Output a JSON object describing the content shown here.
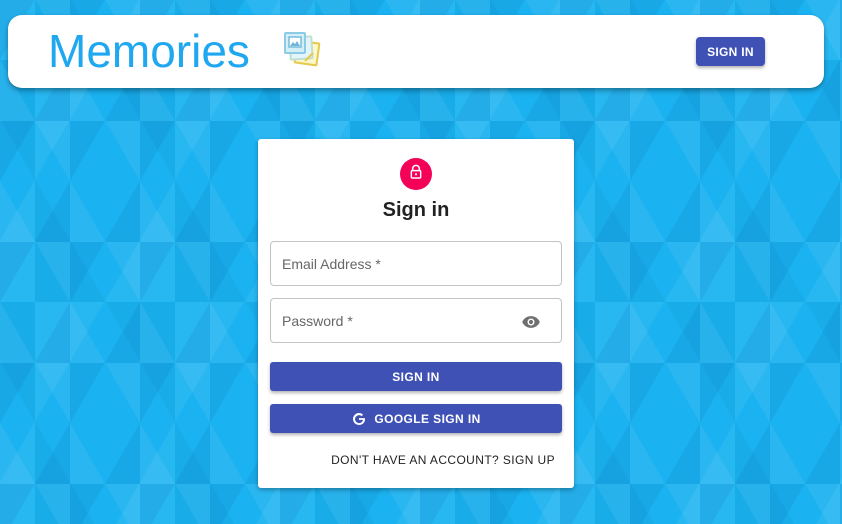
{
  "header": {
    "brand_title": "Memories",
    "brand_logo": "photo-album-icon",
    "signin_label": "SIGN IN"
  },
  "auth_card": {
    "avatar_icon": "lock-icon",
    "title": "Sign in",
    "email_label": "Email Address *",
    "password_label": "Password *",
    "password_toggle_icon": "eye-icon",
    "signin_button_label": "SIGN IN",
    "google_icon": "google-g-icon",
    "google_button_label": "GOOGLE SIGN IN",
    "switch_mode_label": "DON'T HAVE AN ACCOUNT? SIGN UP"
  },
  "colors": {
    "background": "#1ab2f0",
    "brand_title": "#1fa8f0",
    "primary_button": "#3f51b5",
    "avatar": "#f50057"
  }
}
